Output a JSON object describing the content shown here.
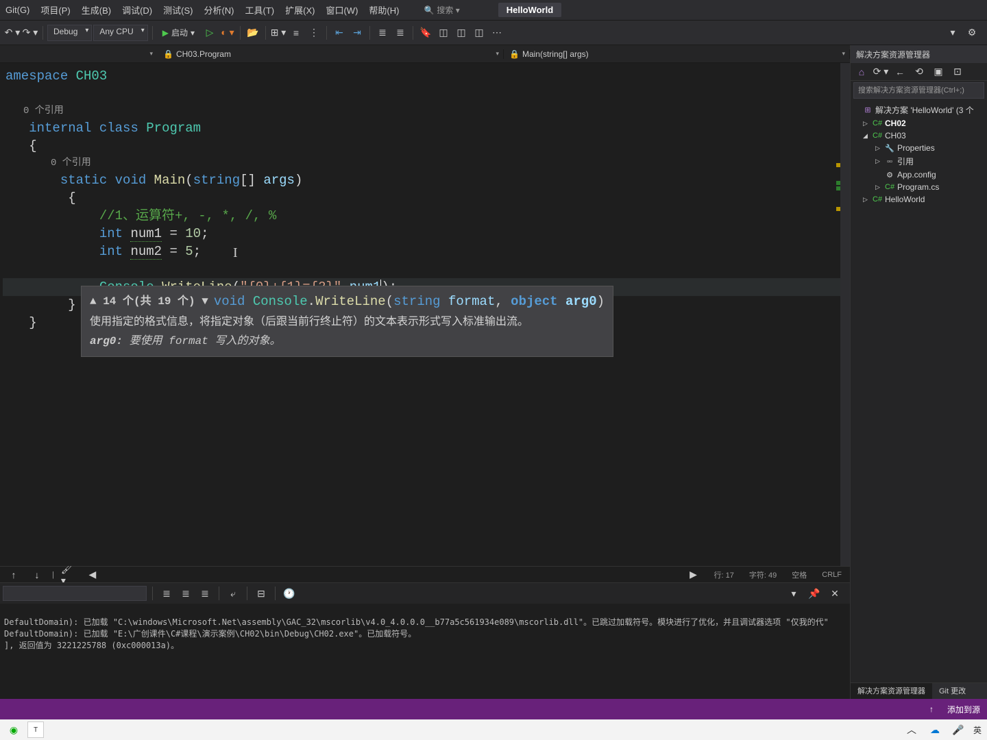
{
  "menu": {
    "git": "Git(G)",
    "project": "项目(P)",
    "build": "生成(B)",
    "debug": "调试(D)",
    "test": "测试(S)",
    "analyze": "分析(N)",
    "tools": "工具(T)",
    "ext": "扩展(X)",
    "window": "窗口(W)",
    "help": "帮助(H)",
    "search": "搜索 ▾"
  },
  "app_title": "HelloWorld",
  "toolbar": {
    "config": "Debug",
    "platform": "Any CPU",
    "run": "启动"
  },
  "breadcrumb": {
    "class": "CH03.Program",
    "method": "Main(string[] args)"
  },
  "code": {
    "l1": "amespace CH03",
    "refs": "0 个引用",
    "cls": "internal class Program",
    "refs2": "0 个引用",
    "sig": "static void Main(string[] args)",
    "comment": "//1、运算符+, -, *, /, %",
    "d1": "int num1 = 10;",
    "d2": "int num2 = 5;",
    "call": "Console.WriteLine(\"{0}+{1}={2}\",num1);"
  },
  "tooltip": {
    "pager": "▲ 14 个(共 19 个) ▼",
    "sig_void": "void",
    "sig_console": "Console",
    "sig_method": "WriteLine",
    "sig_p1type": "string",
    "sig_p1": "format",
    "sig_p2type": "object",
    "sig_p2": "arg0",
    "desc": "使用指定的格式信息，将指定对象（后跟当前行终止符）的文本表示形式写入标准输出流。",
    "param_name": "arg0:",
    "param_desc": "要使用 format 写入的对象。"
  },
  "status": {
    "line": "行: 17",
    "col": "字符: 49",
    "ins": "空格",
    "eol": "CRLF"
  },
  "output": {
    "l1": "DefaultDomain): 已加载 \"C:\\windows\\Microsoft.Net\\assembly\\GAC_32\\mscorlib\\v4.0_4.0.0.0__b77a5c561934e089\\mscorlib.dll\"。已跳过加载符号。模块进行了优化，并且调试器选项 \"仅我的代\"",
    "l2": "DefaultDomain): 已加载 \"E:\\广创课件\\C#课程\\演示案例\\CH02\\bin\\Debug\\CH02.exe\"。已加载符号。",
    "l3": "], 返回值为 3221225788 (0xc000013a)。"
  },
  "sidebar": {
    "title": "解决方案资源管理器",
    "search": "搜索解决方案资源管理器(Ctrl+;)",
    "root": "解决方案 'HelloWorld' (3 个",
    "n1": "CH02",
    "n2": "CH03",
    "n2a": "Properties",
    "n2b": "引用",
    "n2c": "App.config",
    "n2d": "Program.cs",
    "n3": "HelloWorld",
    "tab1": "解决方案资源管理器",
    "tab2": "Git 更改"
  },
  "bottom": {
    "add": "添加到源"
  },
  "tray": {
    "ime": "英"
  }
}
